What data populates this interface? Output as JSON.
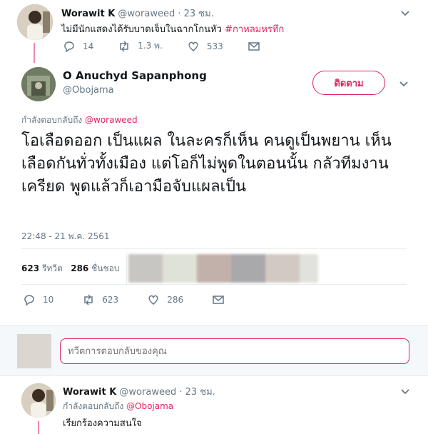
{
  "colors": {
    "accent": "#e0245e",
    "muted": "#657786",
    "divider": "#e6ecf0",
    "gray_band": "#f5f8fa"
  },
  "prev_tweet": {
    "name": "Worawit K",
    "handle": "@woraweed",
    "time": "· 23 ชม.",
    "text_plain": "ไม่มีนักแสดงได้รับบาดเจ็บในฉากโกนหัว ",
    "hashtag": "#กาหลมหรทึก",
    "replies": "14",
    "retweets": "1.3 พ.",
    "likes": "533"
  },
  "main_tweet": {
    "name": "O Anuchyd Sapanphong",
    "handle": "@Obojama",
    "follow_label": "ติดตาม",
    "replying_prefix": "กำลังตอบกลับถึง ",
    "replying_to": "@woraweed",
    "text": "โอเลือดออก เป็นแผล ในละครก็เห็น คนดูเป็นพยาน เห็นเลือดกันทั่วทั้งเมือง แต่โอก็ไม่พูดในตอนนั้น กลัวทีมงานเครียด พูดแล้วก็เอามือจับแผลเป็น",
    "timestamp": "22:48 - 21 พ.ค. 2561",
    "retweet_count": "623",
    "retweet_label": "รีทวีต",
    "like_count": "286",
    "like_label": "ชื่นชอบ",
    "replies": "10",
    "retweets": "623",
    "likes": "286"
  },
  "reply_box": {
    "placeholder": "ทวีตการตอบกลับของคุณ"
  },
  "next_tweet": {
    "name": "Worawit K",
    "handle": "@woraweed",
    "time": "· 23 ชม.",
    "replying_prefix": "กำลังตอบกลับถึง ",
    "replying_to": "@Obojama",
    "text": "เรียกร้องความสนใจ"
  }
}
